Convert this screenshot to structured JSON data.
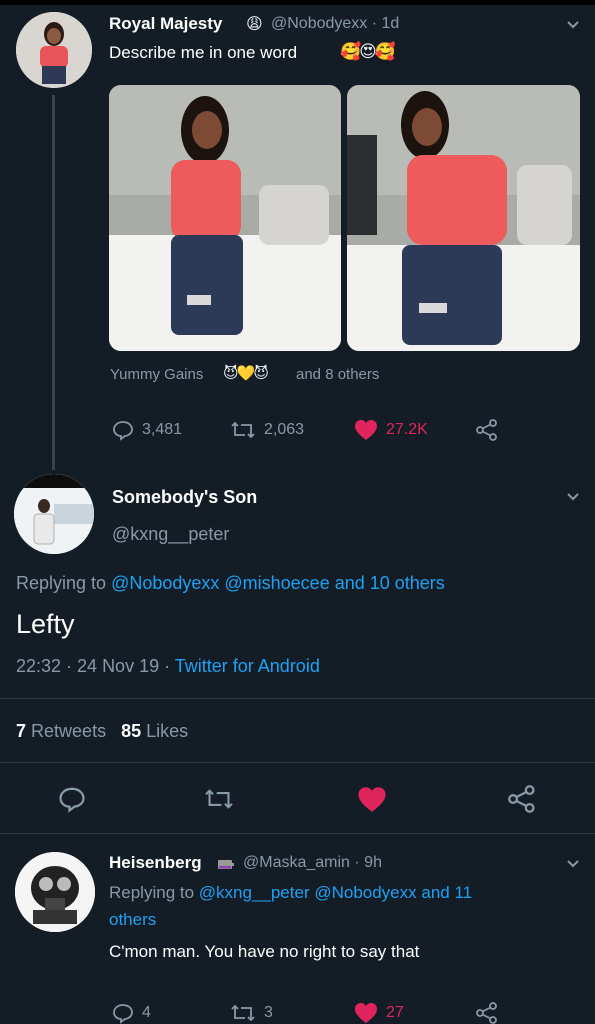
{
  "tweet1": {
    "name": "Royal Majesty",
    "handle_time": "@Nobodyexx · 1d",
    "text": "Describe me in one word",
    "liked_by_name": "Yummy Gains",
    "liked_by_rest": "and 8 others",
    "replies": "3,481",
    "retweets": "2,063",
    "likes": "27.2K"
  },
  "tweet2": {
    "name": "Somebody's Son",
    "handle": "@kxng__peter",
    "replying_prefix": "Replying to ",
    "replying_targets": "@Nobodyexx @mishoecee and 10 others",
    "text": "Lefty",
    "time": "22:32 · 24 Nov 19 · ",
    "client": "Twitter for Android",
    "retweet_count": "7",
    "retweet_label": "Retweets",
    "like_count": "85",
    "like_label": "Likes"
  },
  "tweet3": {
    "name": "Heisenberg",
    "handle_time": "@Maska_amin · 9h",
    "replying_prefix": "Replying to ",
    "replying_targets_line1": "@kxng__peter @Nobodyexx and 11",
    "replying_targets_line2": "others",
    "text": "C'mon man. You have no right to say that",
    "replies": "4",
    "retweets": "3",
    "likes": "27"
  },
  "colors": {
    "background": "#141d26",
    "link": "#1da1f2",
    "like": "#e0245e",
    "muted": "#8899a6"
  }
}
